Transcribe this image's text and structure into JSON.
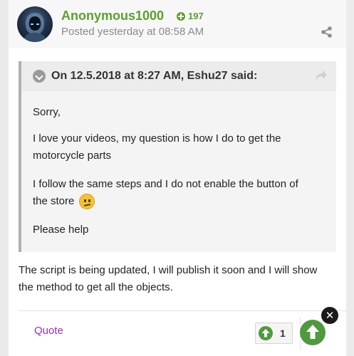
{
  "post": {
    "author": "Anonymous1000",
    "reputation": "197",
    "posted": "Posted yesterday at 08:58 AM"
  },
  "quote": {
    "header": "On 12.5.2018 at 8:27 AM, Eshu27 said:",
    "p1": "Sorry,",
    "p2_line1": "I love your videos, my question is how I do to get the",
    "p2_line2": "motorcycle parts",
    "p3_line1": "I follow the same steps and I do not enable the button of",
    "p3_line2": "the store",
    "p4": "Please help"
  },
  "reply": {
    "line1": "The script is being updated, I will publish it soon and I will show",
    "line2": "the method to get all the objects."
  },
  "footer": {
    "quote_label": "Quote",
    "reaction_count": "1",
    "close_label": "✕"
  },
  "colors": {
    "username": "#5aa02c",
    "accent_green": "#4f9a3c",
    "quote_link": "#9a2fb0"
  },
  "icons": [
    "avatar",
    "reputation-plus-icon",
    "share-icon",
    "chevron-down-icon",
    "go-to-quote-icon",
    "confused-emoji-icon",
    "like-up-arrow-icon",
    "scroll-top-icon",
    "close-icon"
  ]
}
